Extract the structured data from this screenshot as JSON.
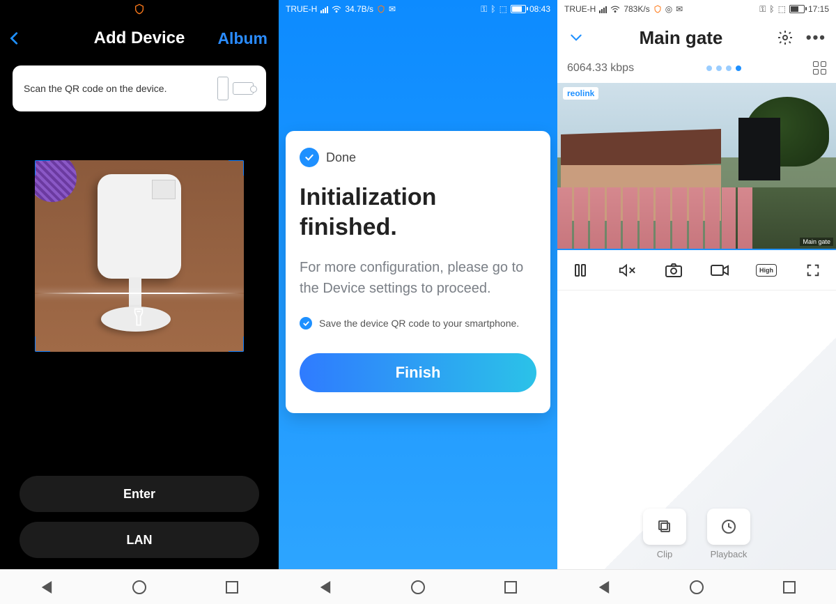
{
  "panel1": {
    "header": {
      "title": "Add Device",
      "album": "Album"
    },
    "hint": "Scan the QR code on the device.",
    "buttons": {
      "enter": "Enter",
      "lan": "LAN"
    }
  },
  "panel2": {
    "status": {
      "carrier": "TRUE-H",
      "rate": "34.7B/s",
      "time": "08:43"
    },
    "done": "Done",
    "heading": "Initialization finished.",
    "subtitle": "For more configuration, please go to the Device settings to proceed.",
    "save_qr": "Save the device QR code to your smartphone.",
    "finish": "Finish"
  },
  "panel3": {
    "status": {
      "carrier": "TRUE-H",
      "rate": "783K/s",
      "time": "17:15"
    },
    "header": {
      "name": "Main gate"
    },
    "bitrate": "6064.33 kbps",
    "video": {
      "logo": "reolink",
      "label": "Main gate"
    },
    "toolbar": {
      "quality": "High"
    },
    "tiles": {
      "clip": "Clip",
      "playback": "Playback"
    }
  }
}
